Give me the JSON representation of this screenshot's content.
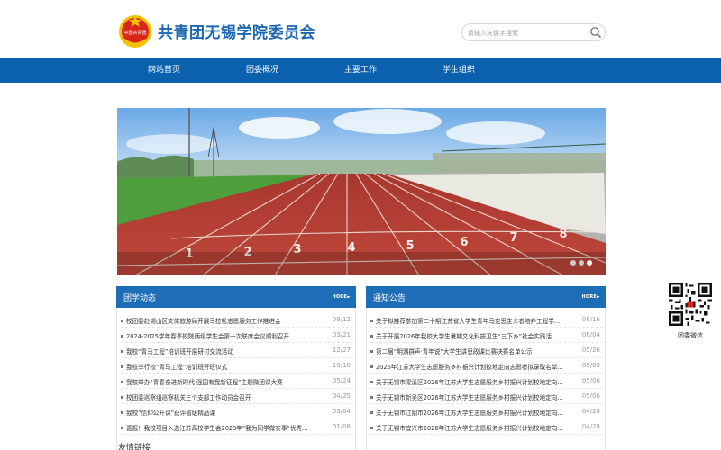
{
  "header": {
    "site_title": "共青团无锡学院委员会",
    "logo_text": "中国共青团",
    "search_placeholder": "请输入关键字搜索"
  },
  "nav": {
    "items": [
      {
        "label": "网站首页"
      },
      {
        "label": "团委概况"
      },
      {
        "label": "主要工作"
      },
      {
        "label": "学生组织"
      }
    ]
  },
  "banner": {
    "lane_numbers": [
      "1",
      "2",
      "3",
      "4",
      "5",
      "6",
      "7",
      "8"
    ],
    "slide_count": 3,
    "active_slide": 3
  },
  "panels": {
    "news": {
      "title": "团学动态",
      "more": "HORE",
      "items": [
        {
          "title": "校团委赴锡山区文体旅游局开展马拉松志愿服务工作推进会",
          "date": "09/12"
        },
        {
          "title": "2024-2025学年春季校院两级学生会第一次联席会议顺利召开",
          "date": "03/21"
        },
        {
          "title": "我校“青马工程”培训班开展研讨交流活动",
          "date": "12/27"
        },
        {
          "title": "我校举行校“青马工程”培训班开班仪式",
          "date": "10/18"
        },
        {
          "title": "我校举办“青春奋进新时代 强国有我新征程”主题微团课大赛",
          "date": "05/24"
        },
        {
          "title": "校团委巡察组巡察机关三个支部工作动员会召开",
          "date": "04/25"
        },
        {
          "title": "我校“信仰公开课”获评省级精品课",
          "date": "03/04"
        },
        {
          "title": "喜报！我校项目入选江苏高校学生会2023年“我为同学做实事”优秀…",
          "date": "01/08"
        }
      ]
    },
    "notice": {
      "title": "通知公告",
      "more": "HORE",
      "items": [
        {
          "title": "关于拟推荐参加第二十期江苏省大学生青年马克思主义者培养工程学…",
          "date": "06/16"
        },
        {
          "title": "关于开展2026年我校大学生暑期文化科技卫生“三下乡”社会实践活…",
          "date": "06/04"
        },
        {
          "title": "第二届“明湖群声·青年说”大学生讲思政课比赛决赛名单公示",
          "date": "05/26"
        },
        {
          "title": "2026年江苏大学生志愿服务乡村振兴计划校地定向志愿者拟录取名单…",
          "date": "05/09"
        },
        {
          "title": "关于无锡市梁溪区2026年江苏大学生志愿服务乡村振兴计划校地定向…",
          "date": "05/06"
        },
        {
          "title": "关于无锡市新吴区2026年江苏大学生志愿服务乡村振兴计划校地定向…",
          "date": "05/06"
        },
        {
          "title": "关于无锡市江阴市2026年江苏大学生志愿服务乡村振兴计划校地定向…",
          "date": "04/28"
        },
        {
          "title": "关于无锡市宜兴市2026年江苏大学生志愿服务乡村振兴计划校地定向…",
          "date": "04/28"
        }
      ]
    }
  },
  "friends_links": {
    "title": "友情链接"
  },
  "qr": {
    "label": "团委微信"
  },
  "colors": {
    "primary": "#0b61ad",
    "panel_head": "#1d6db7",
    "title": "#1d67b1",
    "track": "#b83a2e",
    "turf": "#4f9e3c"
  }
}
